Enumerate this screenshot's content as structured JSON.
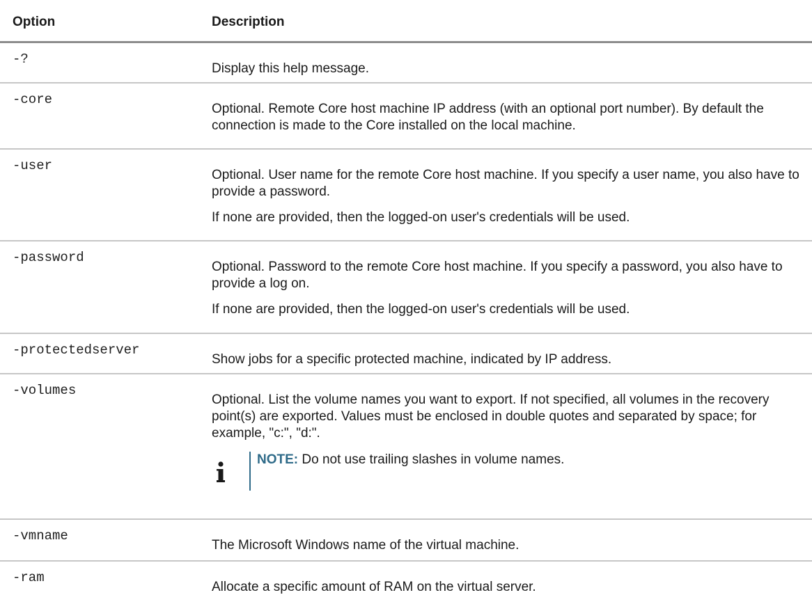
{
  "table": {
    "header_option": "Option",
    "header_description": "Description",
    "rows": [
      {
        "option": "-?",
        "paras": [
          "Display this help message."
        ]
      },
      {
        "option": "-core",
        "paras": [
          "Optional. Remote Core host machine IP address (with an optional port number). By default the connection is made to the Core installed on the local machine."
        ]
      },
      {
        "option": "-user",
        "paras": [
          "Optional. User name for the remote Core host machine. If you specify a user name, you also have to provide a password.",
          "If none are provided, then the logged-on user's credentials will be used."
        ]
      },
      {
        "option": "-password",
        "paras": [
          "Optional. Password to the remote Core host machine. If you specify a password, you also have to provide a log on.",
          "If none are provided, then the logged-on user's credentials will be used."
        ]
      },
      {
        "option": "-protectedserver",
        "paras": [
          "Show jobs for a specific protected machine, indicated by IP address."
        ]
      },
      {
        "option": "-volumes",
        "paras": [
          "Optional. List the volume names you want to export. If not specified, all volumes in the recovery point(s) are exported. Values must be enclosed in double quotes and separated by space; for example, \"c:\", \"d:\"."
        ],
        "note": {
          "label": "NOTE:",
          "text": " Do not use trailing slashes in volume names."
        }
      },
      {
        "option": "-vmname",
        "paras": [
          "The Microsoft Windows name of the virtual machine."
        ]
      },
      {
        "option": "-ram",
        "paras": [
          "Allocate a specific amount of RAM on the virtual server."
        ]
      }
    ]
  },
  "colors": {
    "note_accent": "#2f6b89",
    "header_rule": "#8c8c8c",
    "row_rule": "#c6c6c6"
  },
  "icons": {
    "note": "info-icon"
  }
}
